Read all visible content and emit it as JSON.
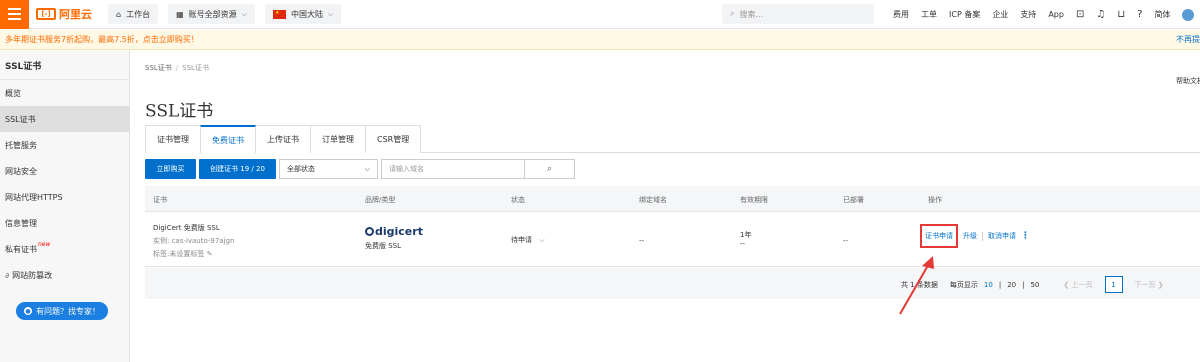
{
  "topbar": {
    "logo": "阿里云",
    "logo_mark": "[-]",
    "workbench": "工作台",
    "account": "账号全部资源",
    "region": "中国大陆",
    "search_placeholder": "搜索...",
    "nav": [
      "费用",
      "工单",
      "ICP 备案",
      "企业",
      "支持",
      "App"
    ],
    "lang": "简体"
  },
  "notice": {
    "text": "多年期证书服务7折起购，最高7.5折，点击立即购买！",
    "right": "不再提"
  },
  "sidebar": {
    "title": "SSL证书",
    "items": [
      {
        "label": "概览"
      },
      {
        "label": "SSL证书"
      },
      {
        "label": "托管服务"
      },
      {
        "label": "网站安全"
      },
      {
        "label": "网站代理HTTPS"
      },
      {
        "label": "信息管理"
      },
      {
        "label": "私有证书",
        "badge": "new"
      },
      {
        "label": "网站防篡改"
      }
    ],
    "help_button": "有问题？找专家！"
  },
  "breadcrumb": {
    "root": "SSL证书",
    "current": "SSL证书"
  },
  "help_doc": "帮助文档",
  "page_title": "SSL证书",
  "tabs": [
    "证书管理",
    "免费证书",
    "上传证书",
    "订单管理",
    "CSR管理"
  ],
  "toolbar": {
    "buy": "立即购买",
    "create": "创建证书 19 / 20",
    "status_select": "全部状态",
    "domain_placeholder": "请输入域名"
  },
  "table": {
    "headers": [
      "证书",
      "品牌/类型",
      "状态",
      "绑定域名",
      "有效期限",
      "已部署",
      "操作"
    ],
    "row": {
      "name": "DigiCert 免费版 SSL",
      "instance": "实例: cas-ivauto-97ajgn",
      "tag": "标签:未设置标签",
      "brand": "digicert",
      "type": "免费版 SSL",
      "status": "待申请",
      "domain": "--",
      "validity": "1年",
      "validity_sub": "--",
      "deployed": "--",
      "op_apply": "证书申请",
      "op_upgrade": "升级",
      "op_cancel": "取消申请"
    }
  },
  "pager": {
    "total": "共 1 条数据",
    "per_page_label": "每页显示",
    "sizes": [
      "10",
      "20",
      "50"
    ],
    "prev": "上一页",
    "page": "1",
    "next": "下一页"
  },
  "colors": {
    "accent": "#0070cc",
    "brand": "#ff6a00",
    "highlight": "#e53935"
  }
}
